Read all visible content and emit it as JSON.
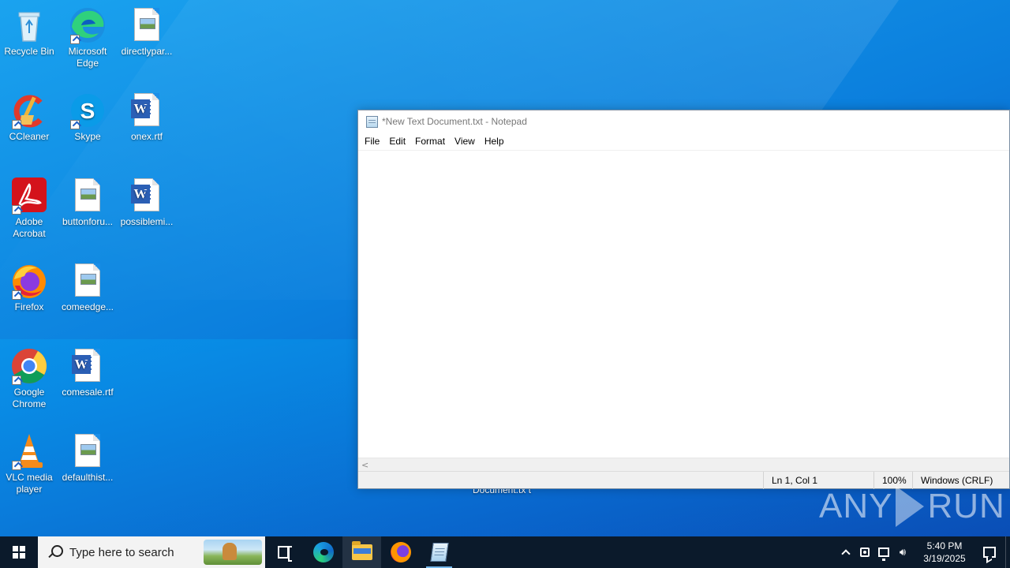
{
  "desktop": {
    "icons": [
      {
        "label": "Recycle Bin",
        "icon": "recycle-bin-icon"
      },
      {
        "label": "Microsoft Edge",
        "icon": "edge-icon"
      },
      {
        "label": "directlypar...",
        "icon": "image-file-icon"
      },
      {
        "label": "CCleaner",
        "icon": "ccleaner-icon"
      },
      {
        "label": "Skype",
        "icon": "skype-icon"
      },
      {
        "label": "onex.rtf",
        "icon": "word-document-icon"
      },
      {
        "label": "Adobe Acrobat",
        "icon": "acrobat-icon"
      },
      {
        "label": "buttonforu...",
        "icon": "image-file-icon"
      },
      {
        "label": "possiblemi...",
        "icon": "word-document-icon"
      },
      {
        "label": "Firefox",
        "icon": "firefox-icon"
      },
      {
        "label": "comeedge...",
        "icon": "image-file-icon"
      },
      {
        "label": "Google Chrome",
        "icon": "chrome-icon"
      },
      {
        "label": "comesale.rtf",
        "icon": "word-document-icon"
      },
      {
        "label": "VLC media player",
        "icon": "vlc-icon"
      },
      {
        "label": "defaulthist...",
        "icon": "image-file-icon"
      }
    ],
    "partial_label": "Document.tx t",
    "watermark": {
      "left": "ANY",
      "right": "RUN"
    }
  },
  "notepad": {
    "title": "*New Text Document.txt - Notepad",
    "menu": [
      "File",
      "Edit",
      "Format",
      "View",
      "Help"
    ],
    "content": "",
    "status": {
      "position": "Ln 1, Col 1",
      "zoom": "100%",
      "line_ending": "Windows (CRLF)"
    }
  },
  "taskbar": {
    "search_placeholder": "Type here to search",
    "clock": {
      "time": "5:40 PM",
      "date": "3/19/2025"
    }
  },
  "colors": {
    "taskbar": "#0b1a2b",
    "desktop_accent": "#0b7fdd"
  }
}
